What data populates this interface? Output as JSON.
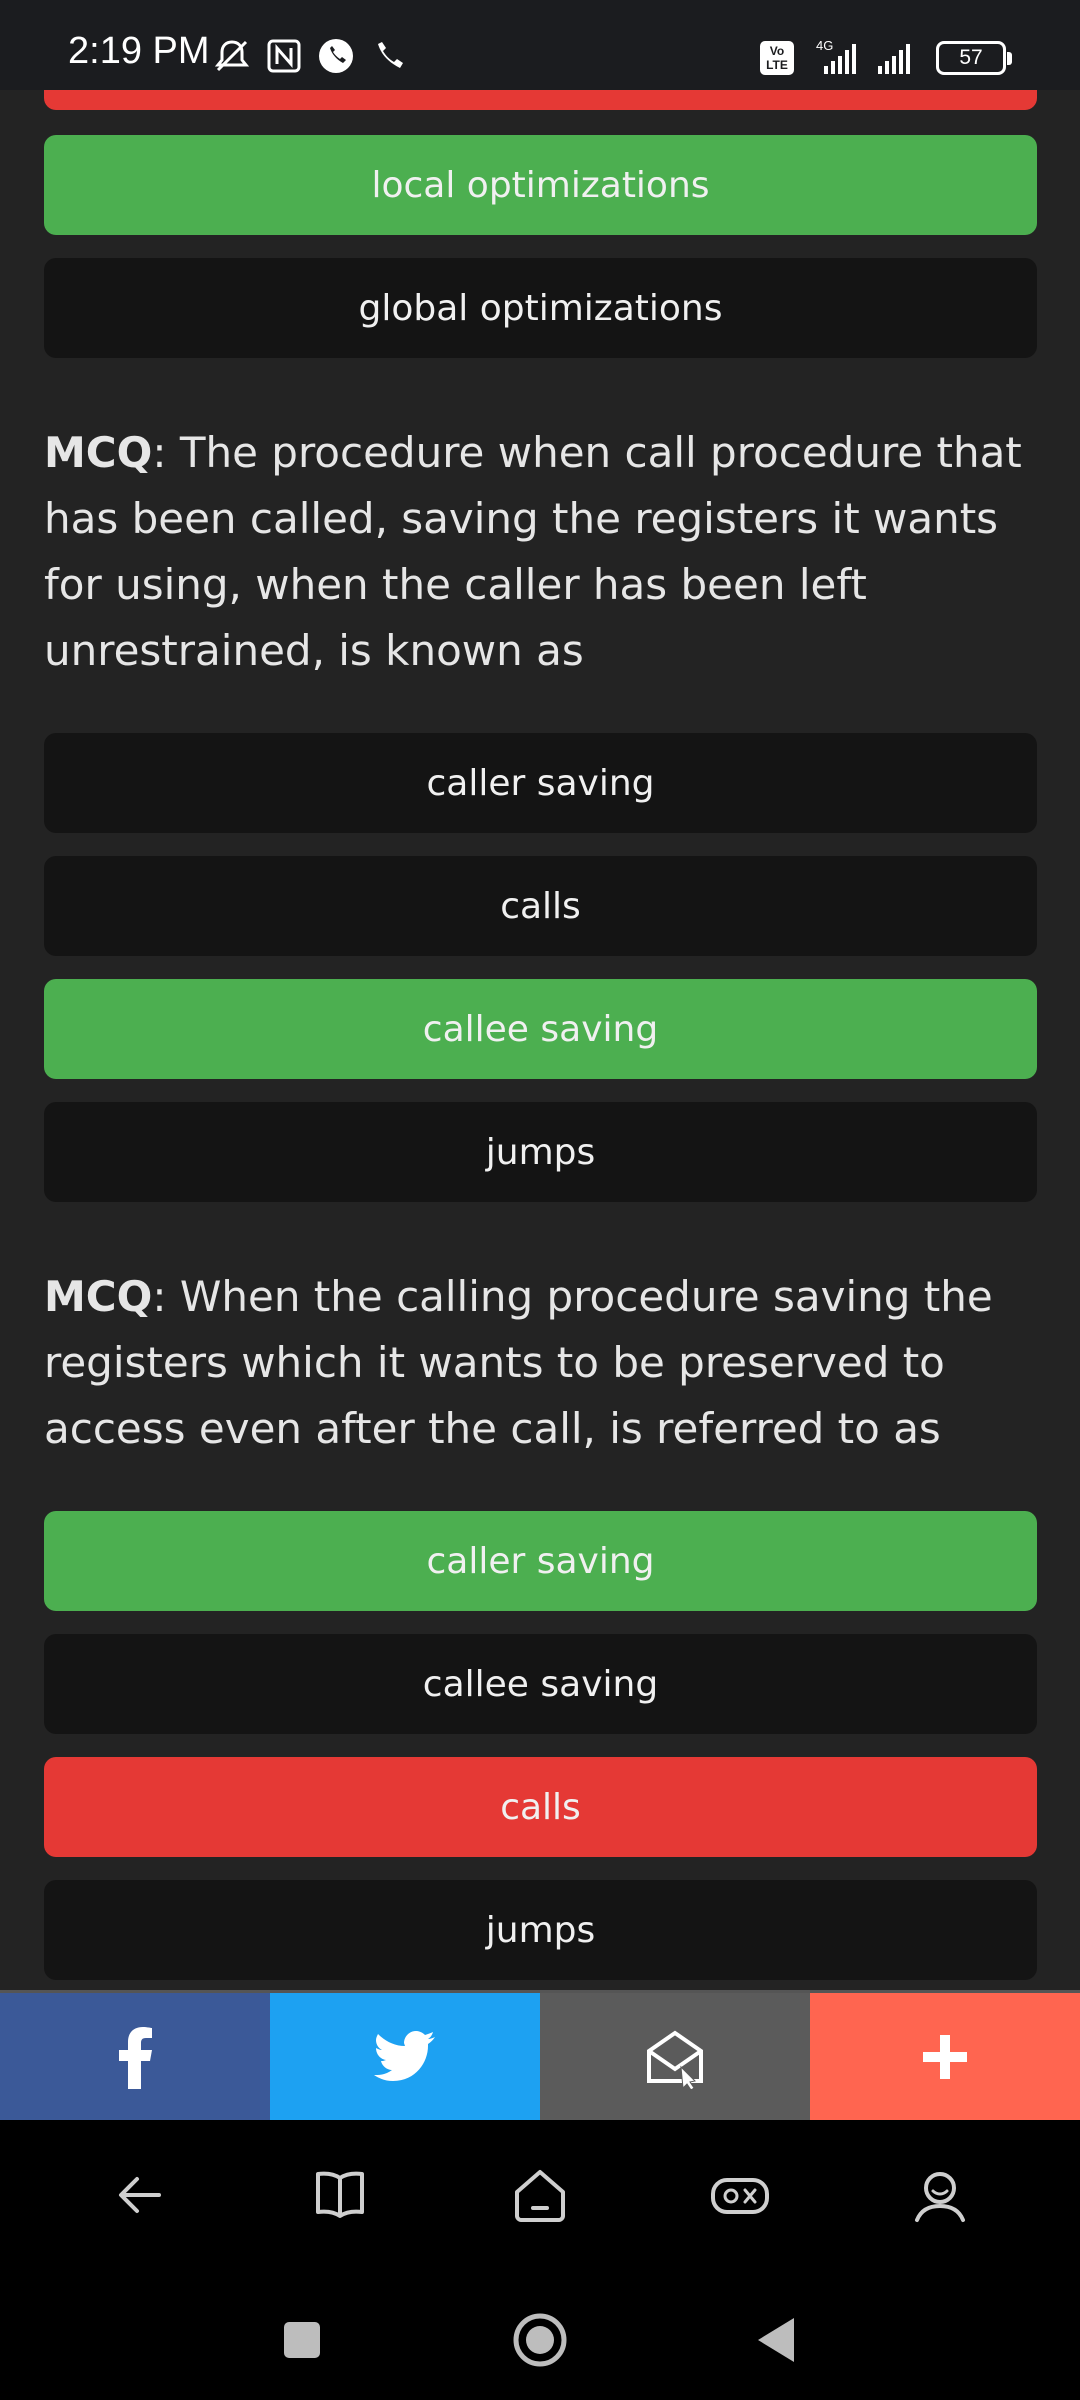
{
  "status": {
    "time": "2:19 PM",
    "network": "4G",
    "volte": "Vo LTE",
    "battery": "57"
  },
  "top_options": [
    {
      "label": "local optimizations",
      "state": "correct"
    },
    {
      "label": "global optimizations",
      "state": "neutral"
    }
  ],
  "questions": [
    {
      "tag": "MCQ",
      "text": ": The procedure when call procedure that has been called, saving the registers it wants for using, when the caller has been left unrestrained, is known as",
      "options": [
        {
          "label": "caller saving",
          "state": "neutral"
        },
        {
          "label": "calls",
          "state": "neutral"
        },
        {
          "label": "callee saving",
          "state": "correct"
        },
        {
          "label": "jumps",
          "state": "neutral"
        }
      ]
    },
    {
      "tag": "MCQ",
      "text": ": When the calling procedure saving the registers which it wants to be preserved to access even after the call, is referred to as",
      "options": [
        {
          "label": "caller saving",
          "state": "correct"
        },
        {
          "label": "callee saving",
          "state": "neutral"
        },
        {
          "label": "calls",
          "state": "wrong"
        },
        {
          "label": "jumps",
          "state": "neutral"
        }
      ]
    }
  ],
  "share": {
    "facebook_icon": "facebook-icon",
    "twitter_icon": "twitter-icon",
    "email_icon": "email-icon",
    "more_icon": "plus-icon"
  },
  "colors": {
    "correct": "#4caf50",
    "wrong": "#e53935",
    "neutral": "#141414",
    "facebook": "#3b5998",
    "twitter": "#1da1f2",
    "email": "#5b5b5b",
    "more": "#ff6550"
  }
}
